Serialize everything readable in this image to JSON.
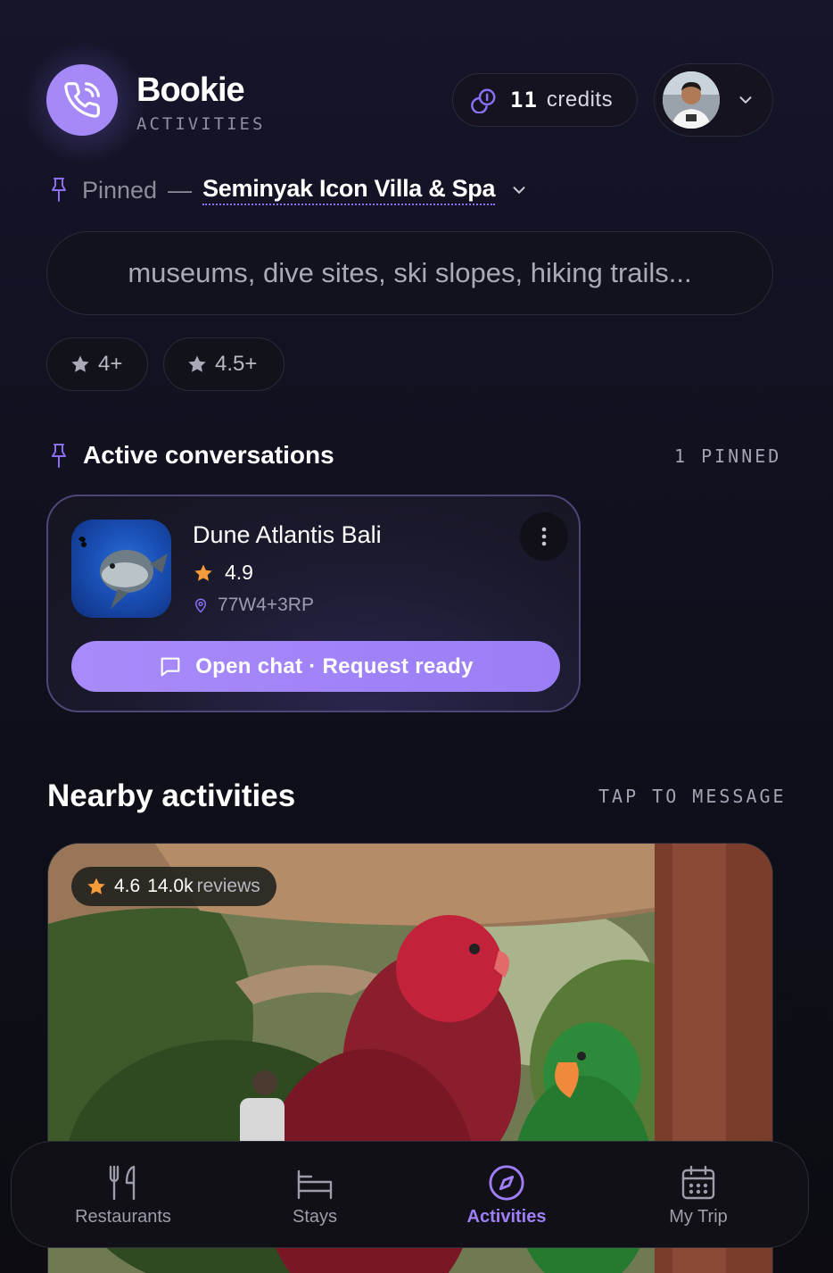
{
  "app": {
    "name": "Bookie",
    "section": "ACTIVITIES",
    "accent_color": "#a58af7"
  },
  "header": {
    "credits_count": "11",
    "credits_label": "credits",
    "credits_icon": "coins-icon",
    "avatar_icon": "user-avatar",
    "menu_icon": "chevron-down-icon"
  },
  "pinned": {
    "prefix": "Pinned",
    "dash": "—",
    "hotel": "Seminyak Icon Villa & Spa",
    "icon": "pin-icon"
  },
  "search": {
    "placeholder": "museums, dive sites, ski slopes, hiking trails..."
  },
  "filters": [
    {
      "label": "4+",
      "icon": "star-icon"
    },
    {
      "label": "4.5+",
      "icon": "star-icon"
    }
  ],
  "active_conversations": {
    "title": "Active conversations",
    "meta": "1 PINNED",
    "items": [
      {
        "name": "Dune Atlantis Bali",
        "rating": "4.9",
        "location": "77W4+3RP",
        "action": "Open chat · Request ready"
      }
    ]
  },
  "nearby": {
    "title": "Nearby activities",
    "meta": "TAP TO MESSAGE",
    "cards": [
      {
        "rating": "4.6",
        "review_count": "14.0k",
        "reviews_label": "reviews"
      }
    ]
  },
  "tabs": [
    {
      "label": "Restaurants",
      "icon": "utensils-icon",
      "active": false
    },
    {
      "label": "Stays",
      "icon": "bed-icon",
      "active": false
    },
    {
      "label": "Activities",
      "icon": "compass-icon",
      "active": true
    },
    {
      "label": "My Trip",
      "icon": "calendar-icon",
      "active": false
    }
  ]
}
